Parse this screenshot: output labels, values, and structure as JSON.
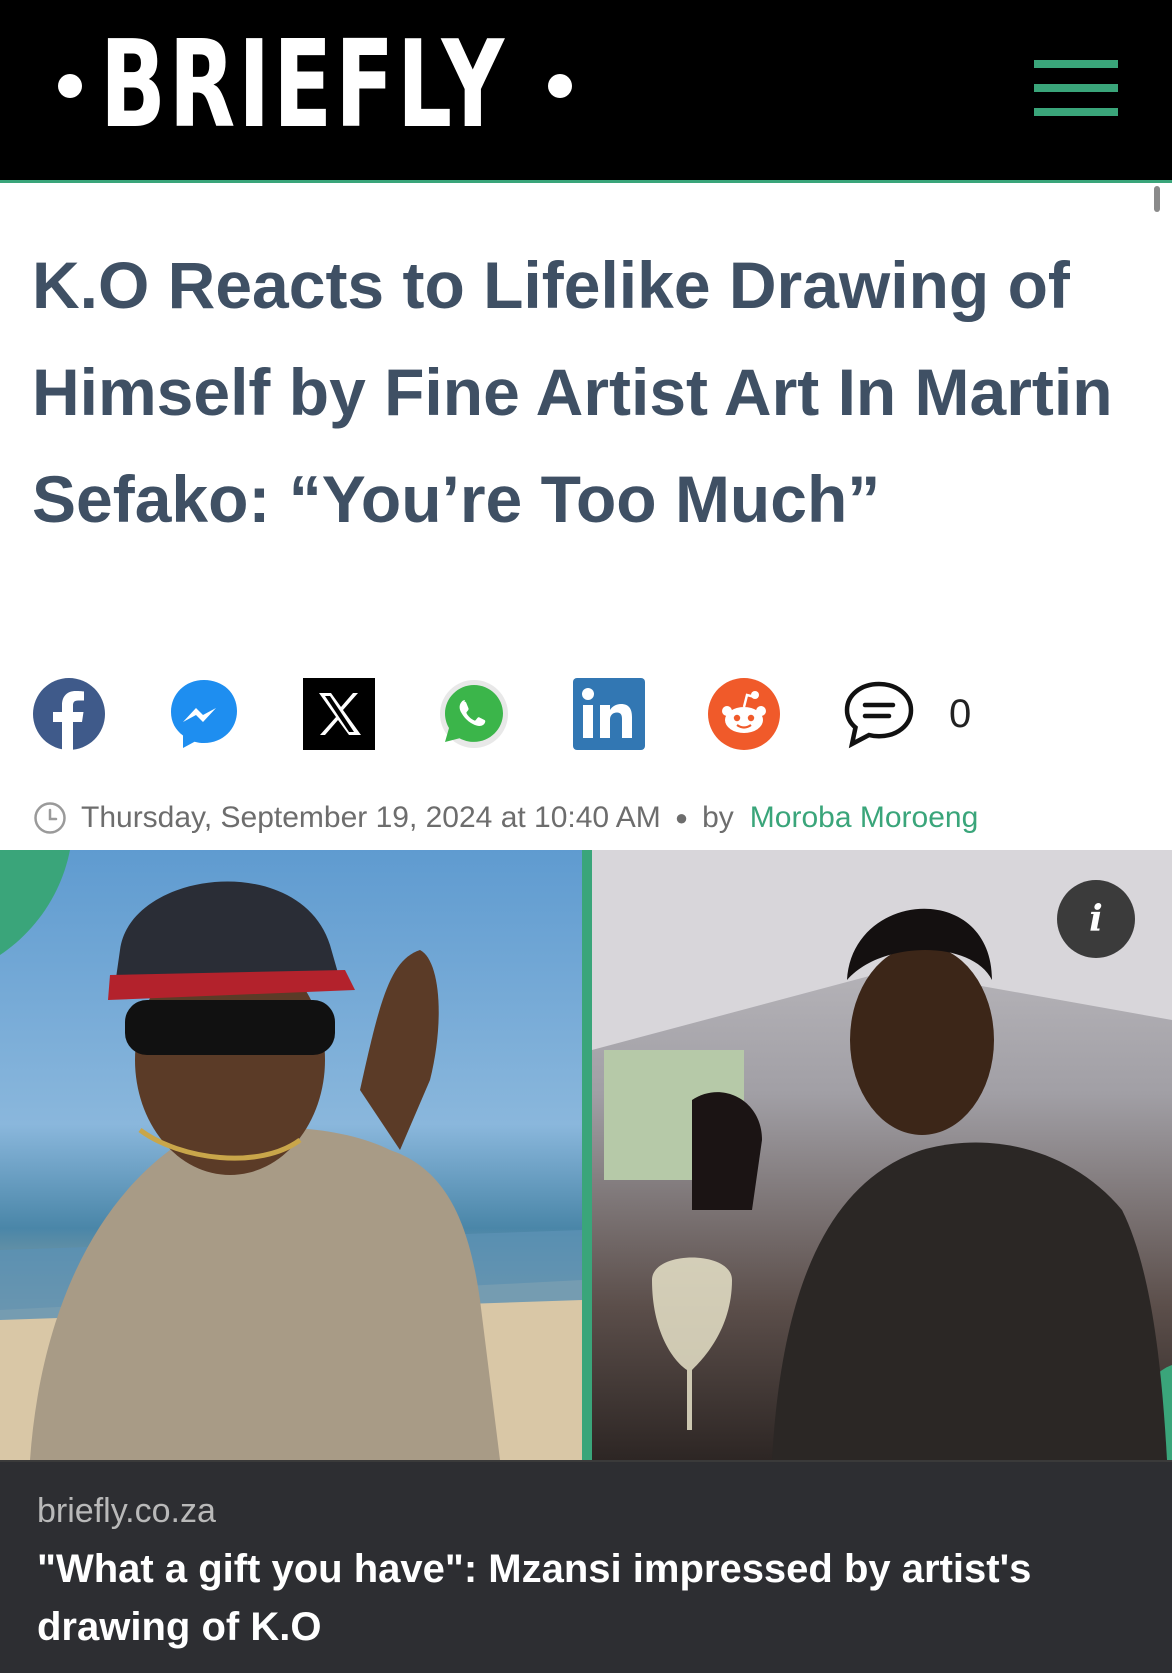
{
  "header": {
    "logo_text": "BRIEFLY",
    "accent_color": "#3aa57a",
    "menu_icon": "hamburger-menu-icon"
  },
  "article": {
    "headline": "K.O Reacts to Lifelike Drawing of Himself by Fine Artist Art In Martin Sefako: “You’re Too Much”",
    "share_buttons": [
      {
        "name": "facebook",
        "icon": "facebook-icon"
      },
      {
        "name": "messenger",
        "icon": "messenger-icon"
      },
      {
        "name": "x",
        "icon": "x-icon"
      },
      {
        "name": "whatsapp",
        "icon": "whatsapp-icon"
      },
      {
        "name": "linkedin",
        "icon": "linkedin-icon"
      },
      {
        "name": "reddit",
        "icon": "reddit-icon"
      },
      {
        "name": "comments",
        "icon": "comment-icon"
      }
    ],
    "comment_count": "0",
    "date": "Thursday, September 19, 2024 at 10:40 AM",
    "by_label": "by",
    "author": "Moroba Moroeng"
  },
  "image": {
    "info_label": "i"
  },
  "caption": {
    "domain": "briefly.co.za",
    "title": "\"What a gift you have\": Mzansi impressed by artist's drawing of K.O"
  }
}
